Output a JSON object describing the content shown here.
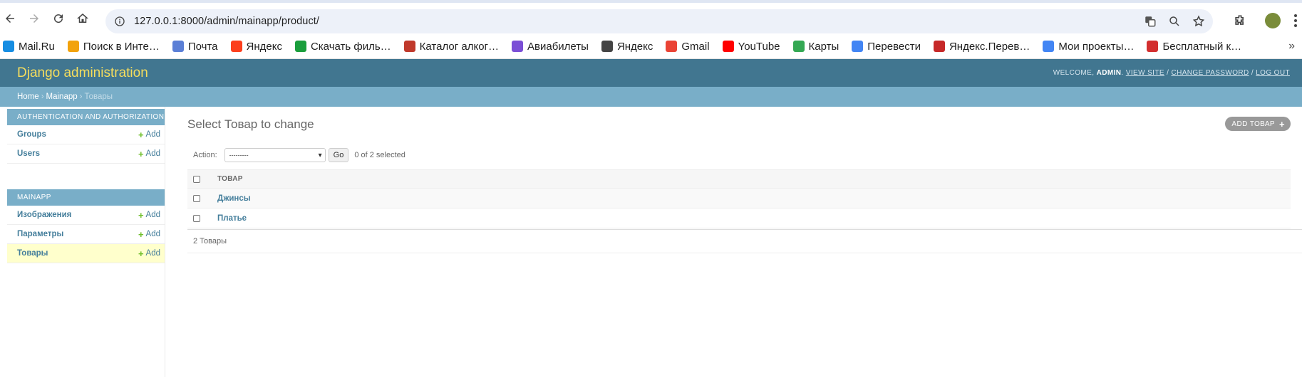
{
  "browser": {
    "url": "127.0.0.1:8000/admin/mainapp/product/",
    "bookmarks": [
      {
        "label": "Mail.Ru",
        "icon": "mailru-icon",
        "color": "#168de2"
      },
      {
        "label": "Поиск в Инте…",
        "icon": "search-key-icon",
        "color": "#f2a20c"
      },
      {
        "label": "Почта",
        "icon": "mail-icon",
        "color": "#5b7fd6"
      },
      {
        "label": "Яндекс",
        "icon": "yandex-icon",
        "color": "#fc3f1d"
      },
      {
        "label": "Скачать филь…",
        "icon": "download-icon",
        "color": "#1a9e3c"
      },
      {
        "label": "Каталог алког…",
        "icon": "winelab-icon",
        "color": "#c0392b"
      },
      {
        "label": "Авиабилеты",
        "icon": "avia-icon",
        "color": "#7b4fd6"
      },
      {
        "label": "Яндекс",
        "icon": "globe-icon",
        "color": "#444444"
      },
      {
        "label": "Gmail",
        "icon": "gmail-icon",
        "color": "#ea4335"
      },
      {
        "label": "YouTube",
        "icon": "youtube-icon",
        "color": "#ff0000"
      },
      {
        "label": "Карты",
        "icon": "maps-icon",
        "color": "#34a853"
      },
      {
        "label": "Перевести",
        "icon": "translate-icon",
        "color": "#4285f4"
      },
      {
        "label": "Яндекс.Перев…",
        "icon": "yandex-translate-icon",
        "color": "#c62828"
      },
      {
        "label": "Мои проекты…",
        "icon": "projects-icon",
        "color": "#4285f4"
      },
      {
        "label": "Бесплатный к…",
        "icon": "l-icon",
        "color": "#d32f2f"
      }
    ]
  },
  "header": {
    "brand": "Django administration",
    "welcome": "Welcome,",
    "user": "admin",
    "view_site": "View site",
    "change_password": "Change password",
    "log_out": "Log out"
  },
  "breadcrumbs": {
    "home": "Home",
    "app": "Mainapp",
    "current": "Товары"
  },
  "sidebar": {
    "modules": [
      {
        "caption": "Authentication and Authorization",
        "rows": [
          {
            "name": "Groups",
            "add": "Add",
            "current": false
          },
          {
            "name": "Users",
            "add": "Add",
            "current": false
          }
        ]
      },
      {
        "caption": "Mainapp",
        "rows": [
          {
            "name": "Изображения",
            "add": "Add",
            "current": false
          },
          {
            "name": "Параметры",
            "add": "Add",
            "current": false
          },
          {
            "name": "Товары",
            "add": "Add",
            "current": true
          }
        ]
      }
    ]
  },
  "content": {
    "title": "Select Товар to change",
    "add_button": "Add Товар",
    "action_label": "Action:",
    "action_value": "---------",
    "go": "Go",
    "selected_count": "0 of 2 selected",
    "column_header": "Товар",
    "rows": [
      "Джинсы",
      "Платье"
    ],
    "paginator": "2 Товары"
  }
}
